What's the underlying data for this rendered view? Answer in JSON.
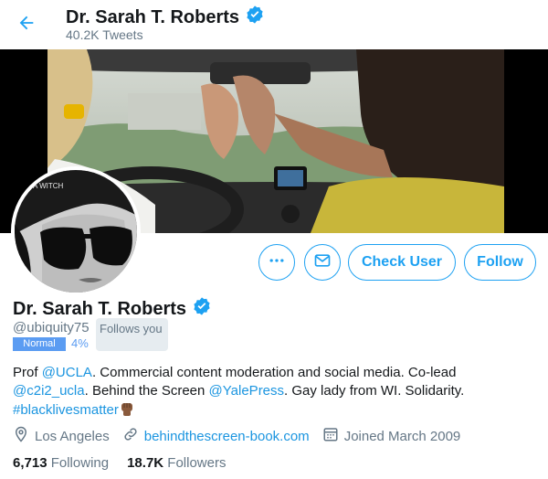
{
  "header": {
    "name": "Dr. Sarah T. Roberts",
    "tweets_count": "40.2K Tweets"
  },
  "banner": {
    "caption": ""
  },
  "avatar": {
    "overlay_text": "A WITCH"
  },
  "actions": {
    "check_user_label": "Check User",
    "follow_label": "Follow"
  },
  "profile": {
    "name": "Dr. Sarah T. Roberts",
    "handle": "@ubiquity75",
    "follows_you": "Follows you",
    "badge": "Normal",
    "percent": "4%",
    "bio": {
      "t1": "Prof ",
      "l1": "@UCLA",
      "t2": ". Commercial content moderation and social media. Co-lead",
      "l2": "@c2i2_ucla",
      "t3": ". Behind the Screen ",
      "l3": "@YalePress",
      "t4": ". Gay lady from WI. Solidarity.",
      "l4": "#blacklivesmatter"
    },
    "location": "Los Angeles",
    "website": "behindthescreen-book.com",
    "joined": "Joined March 2009",
    "following_count": "6,713",
    "following_label": "Following",
    "followers_count": "18.7K",
    "followers_label": "Followers"
  },
  "colors": {
    "accent": "#1da1f2",
    "link": "#1b95e0",
    "muted": "#657786",
    "badge": "#5b9cf2",
    "verified": "#1da1f2"
  },
  "icons": {
    "back": "arrow-left-icon",
    "verified": "verified-badge-icon",
    "more": "more-horizontal-icon",
    "message": "envelope-icon",
    "location": "location-pin-icon",
    "link": "link-icon",
    "calendar": "calendar-icon"
  }
}
